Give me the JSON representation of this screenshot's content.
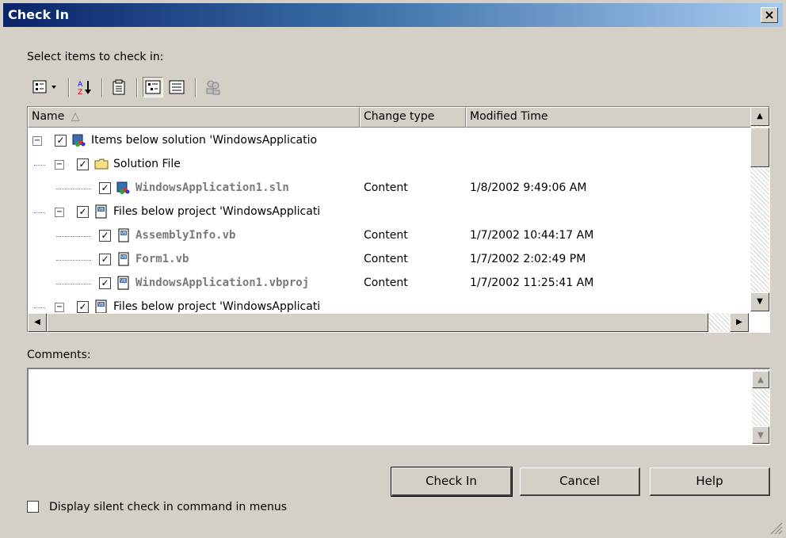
{
  "window": {
    "title": "Check In",
    "close_label": "×"
  },
  "select_label": "Select items to check in:",
  "toolbar": {
    "buttons": [
      {
        "name": "options-dropdown-icon",
        "pressed": false
      },
      {
        "name": "sort-az-icon",
        "pressed": false
      },
      {
        "name": "paste-icon",
        "pressed": false
      },
      {
        "name": "tree-view-icon",
        "pressed": true
      },
      {
        "name": "list-view-icon",
        "pressed": false
      },
      {
        "name": "users-icon",
        "pressed": false
      }
    ]
  },
  "list": {
    "columns": [
      "Name",
      "Change type",
      "Modified Time"
    ],
    "sort_indicator": "△",
    "rows": [
      {
        "name": "Items below solution 'WindowsApplicatio",
        "change": "",
        "time": "",
        "level": 0,
        "expander": "−",
        "bold": false
      },
      {
        "name": "Solution File",
        "change": "",
        "time": "",
        "level": 1,
        "expander": "−",
        "bold": false
      },
      {
        "name": "WindowsApplication1.sln",
        "change": "Content",
        "time": "1/8/2002 9:49:06 AM",
        "level": 2,
        "expander": "",
        "bold": true
      },
      {
        "name": "Files below project 'WindowsApplicati",
        "change": "",
        "time": "",
        "level": 1,
        "expander": "−",
        "bold": false
      },
      {
        "name": "AssemblyInfo.vb",
        "change": "Content",
        "time": "1/7/2002 10:44:17 AM",
        "level": 2,
        "expander": "",
        "bold": true
      },
      {
        "name": "Form1.vb",
        "change": "Content",
        "time": "1/7/2002 2:02:49 PM",
        "level": 2,
        "expander": "",
        "bold": true
      },
      {
        "name": "WindowsApplication1.vbproj",
        "change": "Content",
        "time": "1/7/2002 11:25:41 AM",
        "level": 2,
        "expander": "",
        "bold": true
      },
      {
        "name": "Files below project 'WindowsApplicati",
        "change": "",
        "time": "",
        "level": 1,
        "expander": "−",
        "bold": false
      }
    ]
  },
  "comments_label": "Comments:",
  "comments_value": "",
  "buttons": {
    "check_in": "Check In",
    "cancel": "Cancel",
    "help": "Help"
  },
  "silent_checkbox_label": "Display silent check in command in menus",
  "silent_checkbox_checked": false
}
